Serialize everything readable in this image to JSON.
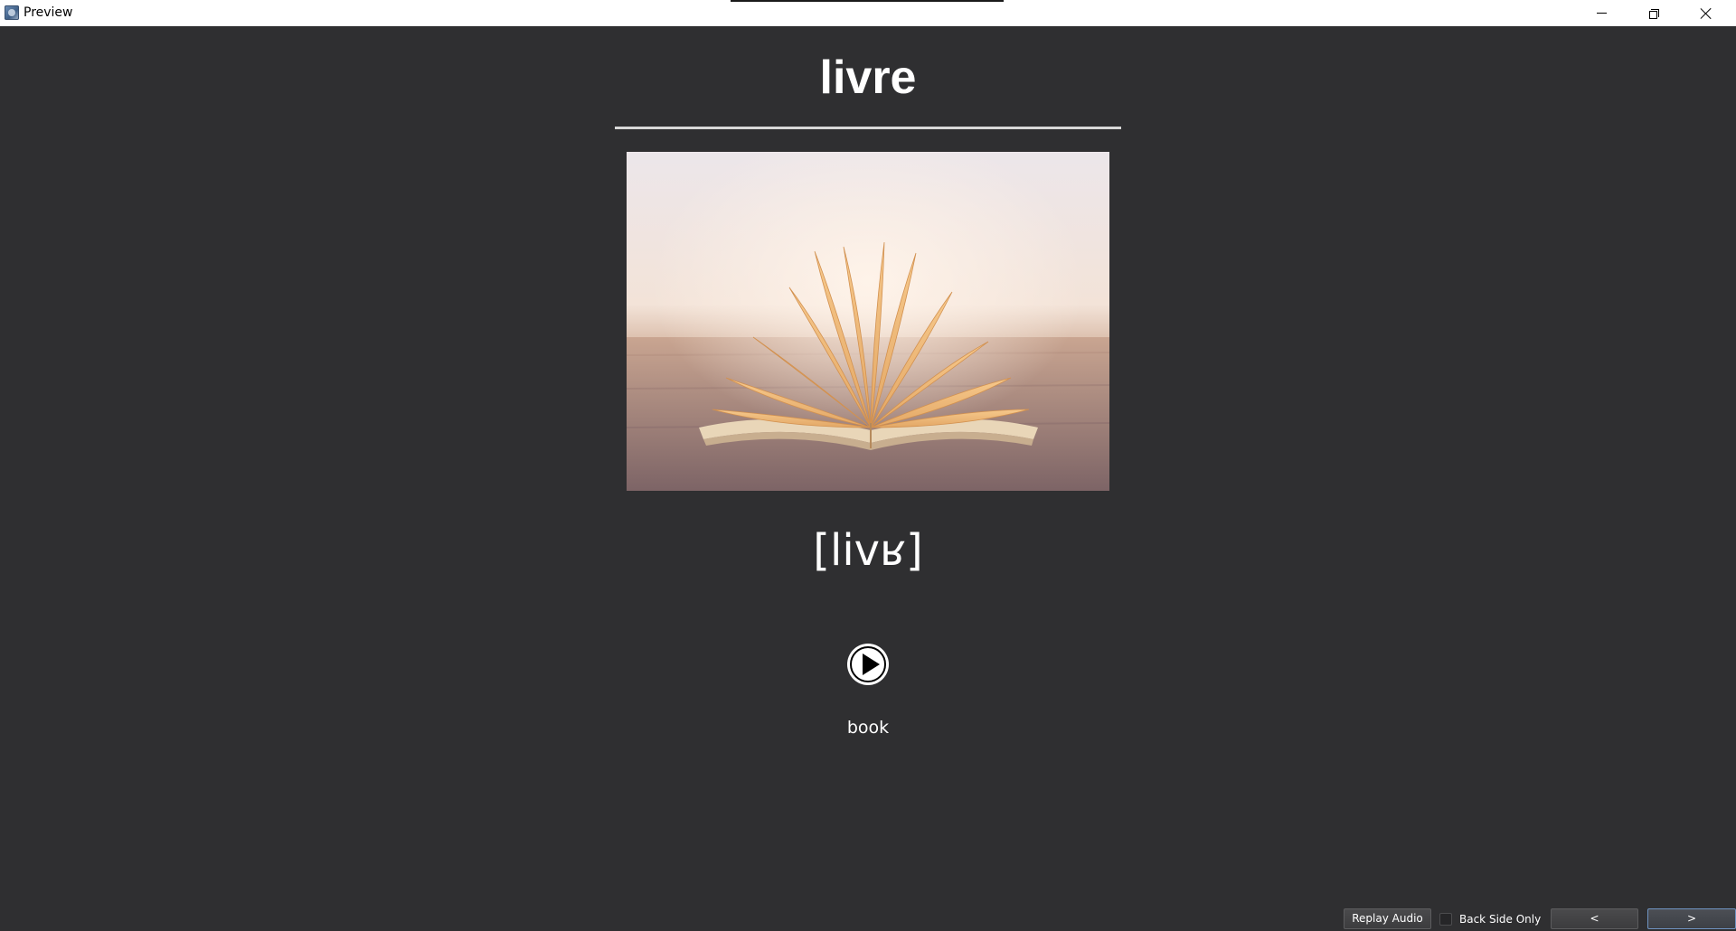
{
  "window": {
    "title": "Preview",
    "icon": "preview-app-icon"
  },
  "card": {
    "front_word": "livre",
    "image_description_icon": "open-book-photo",
    "ipa": "[livʁ]",
    "audio_icon": "play-icon",
    "translation": "book"
  },
  "controls": {
    "replay_label": "Replay Audio",
    "back_side_only_label": "Back Side Only",
    "back_side_only_checked": false,
    "prev_label": "<",
    "next_label": ">"
  },
  "colors": {
    "background": "#2f2f31",
    "text": "#ffffff",
    "divider": "#d8d8d8",
    "next_button_border": "#6f93c1"
  }
}
